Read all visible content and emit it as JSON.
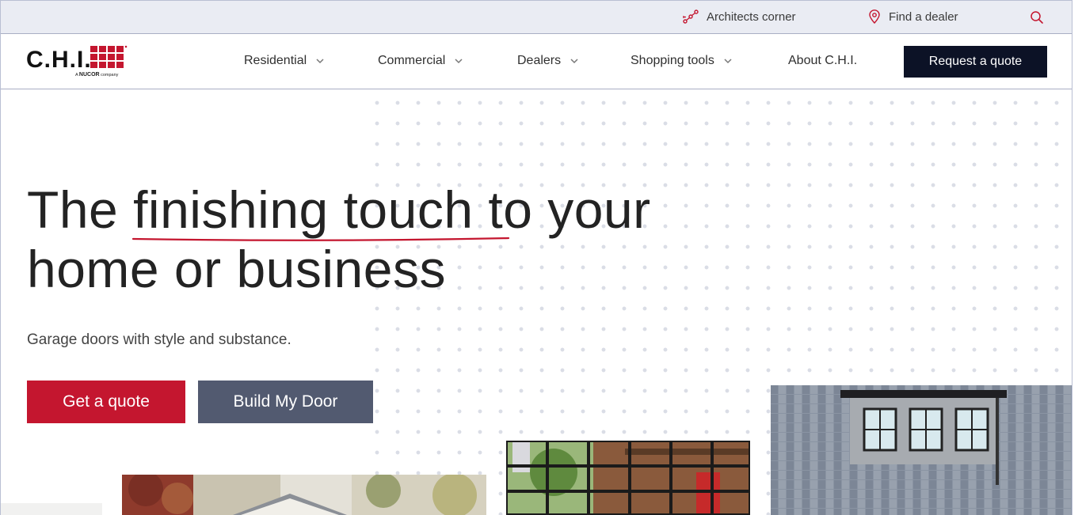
{
  "utility": {
    "architects_label": "Architects corner",
    "dealer_label": "Find a dealer",
    "search_icon": "search-icon"
  },
  "nav": {
    "logo_text": "C.H.I.",
    "logo_sub": "A NUCOR company",
    "items": [
      {
        "label": "Residential",
        "has_dropdown": true
      },
      {
        "label": "Commercial",
        "has_dropdown": true
      },
      {
        "label": "Dealers",
        "has_dropdown": true
      },
      {
        "label": "Shopping tools",
        "has_dropdown": true
      },
      {
        "label": "About C.H.I.",
        "has_dropdown": false
      }
    ],
    "cta_label": "Request a quote"
  },
  "hero": {
    "title_part1": "The ",
    "title_highlight": "finishing touch",
    "title_part2": " to your",
    "title_line2": "home or business",
    "subtitle": "Garage doors with style and substance.",
    "primary_button": "Get a quote",
    "secondary_button": "Build My Door"
  },
  "colors": {
    "brand_red": "#c4162f",
    "navy": "#0c1226",
    "slate": "#525a70",
    "utility_bg": "#eaecf3"
  }
}
